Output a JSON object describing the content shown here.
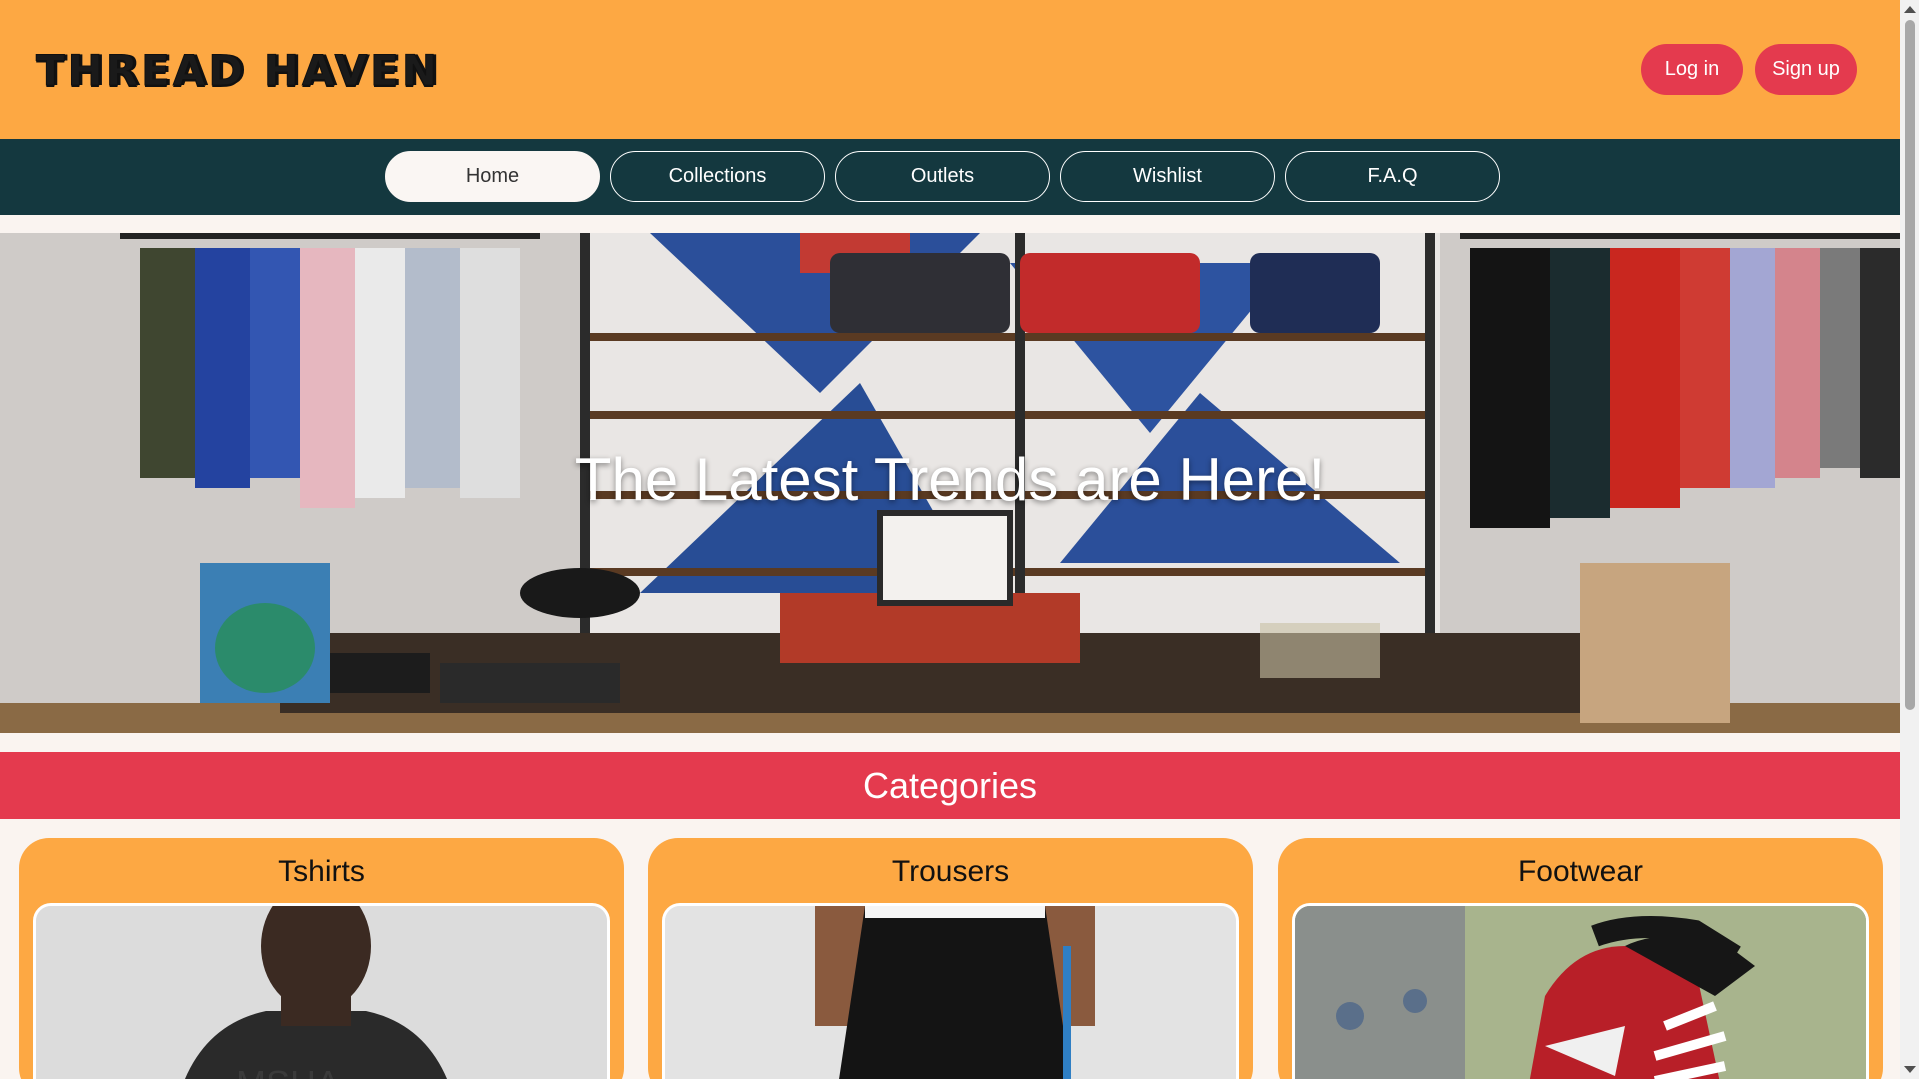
{
  "header": {
    "logo": "THREAD HAVEN",
    "login_label": "Log in",
    "signup_label": "Sign up"
  },
  "nav": {
    "tabs": [
      {
        "label": "Home",
        "active": true
      },
      {
        "label": "Collections",
        "active": false
      },
      {
        "label": "Outlets",
        "active": false
      },
      {
        "label": "Wishlist",
        "active": false
      },
      {
        "label": "F.A.Q",
        "active": false
      }
    ]
  },
  "hero": {
    "title": "The Latest Trends are Here!"
  },
  "categories": {
    "heading": "Categories",
    "items": [
      {
        "label": "Tshirts"
      },
      {
        "label": "Trousers"
      },
      {
        "label": "Footwear"
      }
    ]
  },
  "colors": {
    "header_bg": "#fda843",
    "nav_bg": "#14383f",
    "accent": "#e43a4e",
    "card_bg": "#fda843"
  }
}
